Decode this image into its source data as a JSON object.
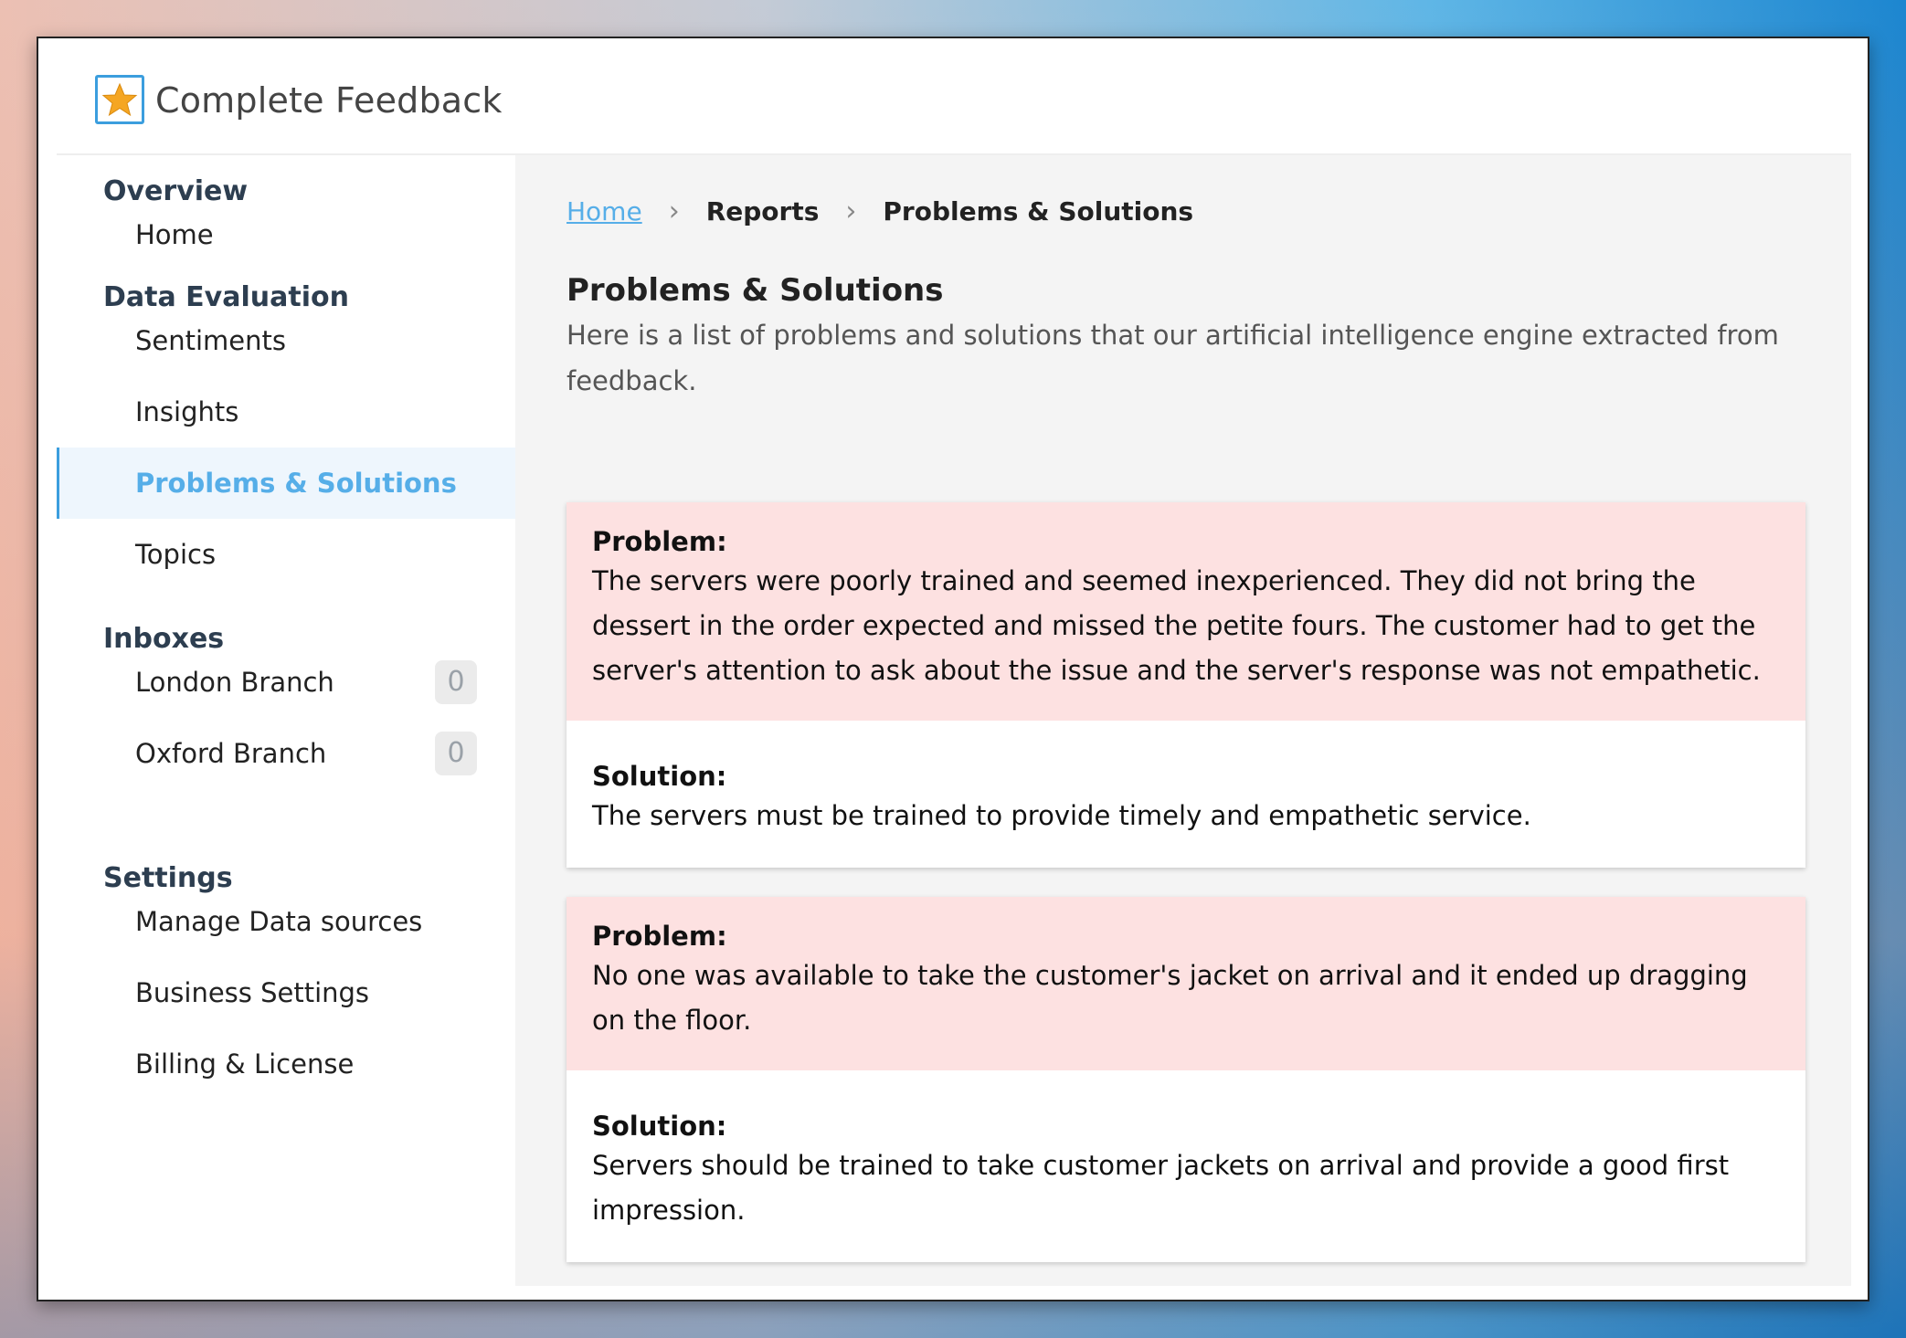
{
  "app": {
    "title": "Complete Feedback",
    "logo_icon": "star-icon"
  },
  "colors": {
    "accent": "#56aee8",
    "problem_bg": "#fde1e1",
    "main_bg": "#f4f4f4"
  },
  "sidebar": {
    "sections": [
      {
        "title": "Overview",
        "items": [
          {
            "label": "Home"
          }
        ]
      },
      {
        "title": "Data Evaluation",
        "items": [
          {
            "label": "Sentiments"
          },
          {
            "label": "Insights"
          },
          {
            "label": "Problems & Solutions",
            "active": true
          },
          {
            "label": "Topics"
          }
        ]
      },
      {
        "title": "Inboxes",
        "items": [
          {
            "label": "London Branch",
            "count": "0"
          },
          {
            "label": "Oxford Branch",
            "count": "0"
          }
        ]
      },
      {
        "title": "Settings",
        "items": [
          {
            "label": "Manage Data sources"
          },
          {
            "label": "Business Settings"
          },
          {
            "label": "Billing & License"
          }
        ]
      }
    ]
  },
  "breadcrumb": [
    "Home",
    "Reports",
    "Problems & Solutions"
  ],
  "page": {
    "title": "Problems & Solutions",
    "description": "Here is a list of problems and solutions that our artificial intelligence engine extracted from feedback."
  },
  "cards": [
    {
      "problem_label": "Problem:",
      "problem": "The servers were poorly trained and seemed inexperienced. They did not bring the dessert in the order expected and missed the petite fours. The customer had to get the server's attention to ask about the issue and the server's response was not empathetic.",
      "solution_label": "Solution:",
      "solution": "The servers must be trained to provide timely and empathetic service."
    },
    {
      "problem_label": "Problem:",
      "problem": "No one was available to take the customer's jacket on arrival and it ended up dragging on the floor.",
      "solution_label": "Solution:",
      "solution": "Servers should be trained to take customer jackets on arrival and provide a good first impression."
    }
  ]
}
